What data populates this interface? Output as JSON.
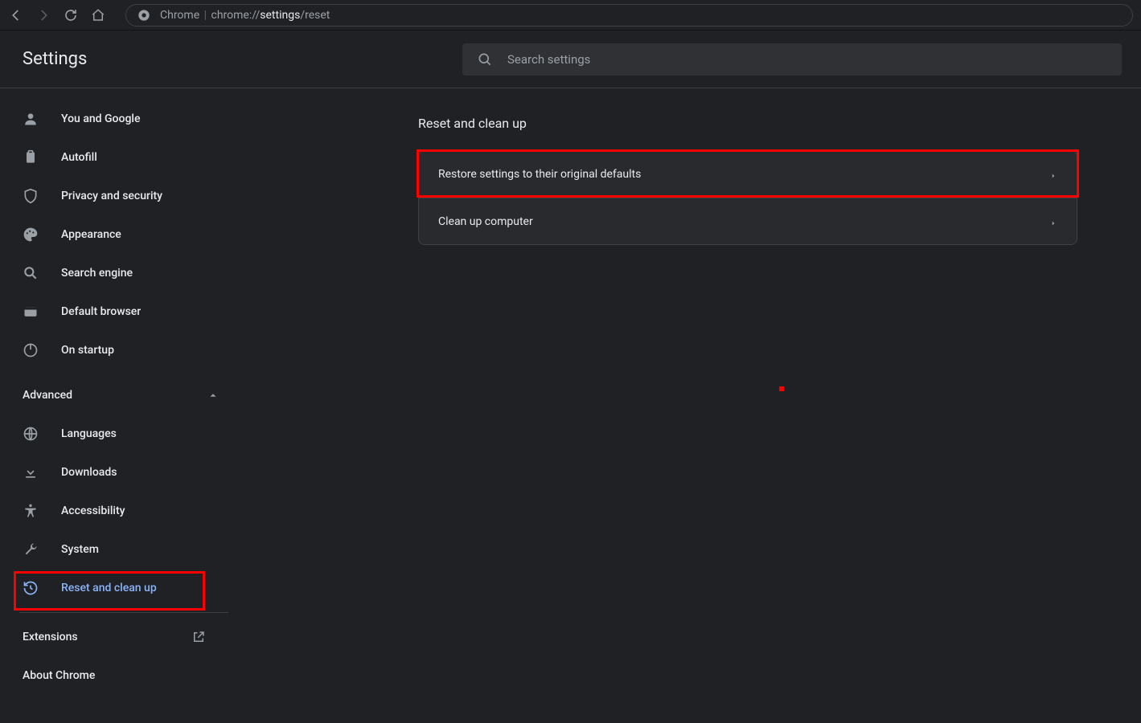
{
  "omnibox": {
    "prefix": "Chrome",
    "sep": "|",
    "url_dim": "chrome://",
    "url_bold": "settings",
    "url_tail": "/reset"
  },
  "header": {
    "title": "Settings"
  },
  "search": {
    "placeholder": "Search settings"
  },
  "sidebar": {
    "items": [
      {
        "label": "You and Google"
      },
      {
        "label": "Autofill"
      },
      {
        "label": "Privacy and security"
      },
      {
        "label": "Appearance"
      },
      {
        "label": "Search engine"
      },
      {
        "label": "Default browser"
      },
      {
        "label": "On startup"
      }
    ],
    "advanced_label": "Advanced",
    "adv_items": [
      {
        "label": "Languages"
      },
      {
        "label": "Downloads"
      },
      {
        "label": "Accessibility"
      },
      {
        "label": "System"
      },
      {
        "label": "Reset and clean up"
      }
    ],
    "extensions": "Extensions",
    "about": "About Chrome"
  },
  "main": {
    "section_title": "Reset and clean up",
    "rows": [
      {
        "label": "Restore settings to their original defaults"
      },
      {
        "label": "Clean up computer"
      }
    ]
  }
}
